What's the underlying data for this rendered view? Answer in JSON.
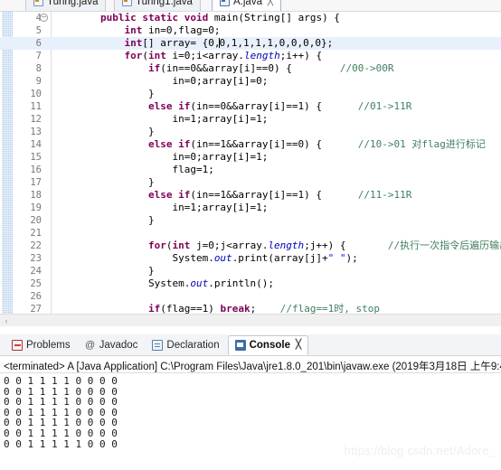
{
  "window": {
    "tabs": [
      {
        "label": "Turing.java",
        "active": false,
        "icon": "java-file-icon"
      },
      {
        "label": "Turing1.java",
        "active": false,
        "icon": "java-file-icon"
      },
      {
        "label": "A.java",
        "active": true,
        "icon": "java-file-icon",
        "close": "╳"
      }
    ]
  },
  "editor": {
    "lines": [
      {
        "num": "4",
        "fold": true,
        "current": false,
        "indent": 2,
        "tokens": [
          {
            "t": "kw",
            "v": "public"
          },
          {
            "t": "p",
            "v": " "
          },
          {
            "t": "kw",
            "v": "static"
          },
          {
            "t": "p",
            "v": " "
          },
          {
            "t": "kw",
            "v": "void"
          },
          {
            "t": "p",
            "v": " main(String[] args) {"
          }
        ]
      },
      {
        "num": "5",
        "fold": false,
        "current": false,
        "indent": 3,
        "tokens": [
          {
            "t": "kw",
            "v": "int"
          },
          {
            "t": "p",
            "v": " in=0,flag=0;"
          }
        ]
      },
      {
        "num": "6",
        "fold": false,
        "current": true,
        "indent": 3,
        "tokens": [
          {
            "t": "kw",
            "v": "int"
          },
          {
            "t": "p",
            "v": "[] array= {0,"
          },
          {
            "t": "caret",
            "v": ""
          },
          {
            "t": "p",
            "v": "0,1,1,1,1,0,0,0,0};"
          }
        ]
      },
      {
        "num": "7",
        "fold": false,
        "current": false,
        "indent": 3,
        "tokens": [
          {
            "t": "kw",
            "v": "for"
          },
          {
            "t": "p",
            "v": "("
          },
          {
            "t": "kw",
            "v": "int"
          },
          {
            "t": "p",
            "v": " i=0;i<array."
          },
          {
            "t": "fld",
            "v": "length"
          },
          {
            "t": "p",
            "v": ";i++) {"
          }
        ]
      },
      {
        "num": "8",
        "fold": false,
        "current": false,
        "indent": 4,
        "tokens": [
          {
            "t": "kw",
            "v": "if"
          },
          {
            "t": "p",
            "v": "(in==0&&array[i]==0) {"
          },
          {
            "t": "gap",
            "v": "        "
          },
          {
            "t": "cmt",
            "v": "//00->00R"
          }
        ]
      },
      {
        "num": "9",
        "fold": false,
        "current": false,
        "indent": 5,
        "tokens": [
          {
            "t": "p",
            "v": "in=0;array[i]=0;"
          }
        ]
      },
      {
        "num": "10",
        "fold": false,
        "current": false,
        "indent": 4,
        "tokens": [
          {
            "t": "p",
            "v": "}"
          }
        ]
      },
      {
        "num": "11",
        "fold": false,
        "current": false,
        "indent": 4,
        "tokens": [
          {
            "t": "kw",
            "v": "else"
          },
          {
            "t": "p",
            "v": " "
          },
          {
            "t": "kw",
            "v": "if"
          },
          {
            "t": "p",
            "v": "(in==0&&array[i]==1) {"
          },
          {
            "t": "gap",
            "v": "      "
          },
          {
            "t": "cmt",
            "v": "//01->11R"
          }
        ]
      },
      {
        "num": "12",
        "fold": false,
        "current": false,
        "indent": 5,
        "tokens": [
          {
            "t": "p",
            "v": "in=1;array[i]=1;"
          }
        ]
      },
      {
        "num": "13",
        "fold": false,
        "current": false,
        "indent": 4,
        "tokens": [
          {
            "t": "p",
            "v": "}"
          }
        ]
      },
      {
        "num": "14",
        "fold": false,
        "current": false,
        "indent": 4,
        "tokens": [
          {
            "t": "kw",
            "v": "else"
          },
          {
            "t": "p",
            "v": " "
          },
          {
            "t": "kw",
            "v": "if"
          },
          {
            "t": "p",
            "v": "(in==1&&array[i]==0) {"
          },
          {
            "t": "gap",
            "v": "      "
          },
          {
            "t": "cmt",
            "v": "//10->01 对flag进行标记"
          }
        ]
      },
      {
        "num": "15",
        "fold": false,
        "current": false,
        "indent": 5,
        "tokens": [
          {
            "t": "p",
            "v": "in=0;array[i]=1;"
          }
        ]
      },
      {
        "num": "16",
        "fold": false,
        "current": false,
        "indent": 5,
        "tokens": [
          {
            "t": "p",
            "v": "flag=1;"
          }
        ]
      },
      {
        "num": "17",
        "fold": false,
        "current": false,
        "indent": 4,
        "tokens": [
          {
            "t": "p",
            "v": "}"
          }
        ]
      },
      {
        "num": "18",
        "fold": false,
        "current": false,
        "indent": 4,
        "tokens": [
          {
            "t": "kw",
            "v": "else"
          },
          {
            "t": "p",
            "v": " "
          },
          {
            "t": "kw",
            "v": "if"
          },
          {
            "t": "p",
            "v": "(in==1&&array[i]==1) {"
          },
          {
            "t": "gap",
            "v": "      "
          },
          {
            "t": "cmt",
            "v": "//11->11R"
          }
        ]
      },
      {
        "num": "19",
        "fold": false,
        "current": false,
        "indent": 5,
        "tokens": [
          {
            "t": "p",
            "v": "in=1;array[i]=1;"
          }
        ]
      },
      {
        "num": "20",
        "fold": false,
        "current": false,
        "indent": 4,
        "tokens": [
          {
            "t": "p",
            "v": "}"
          }
        ]
      },
      {
        "num": "21",
        "fold": false,
        "current": false,
        "indent": 0,
        "tokens": []
      },
      {
        "num": "22",
        "fold": false,
        "current": false,
        "indent": 4,
        "tokens": [
          {
            "t": "kw",
            "v": "for"
          },
          {
            "t": "p",
            "v": "("
          },
          {
            "t": "kw",
            "v": "int"
          },
          {
            "t": "p",
            "v": " j=0;j<array."
          },
          {
            "t": "fld",
            "v": "length"
          },
          {
            "t": "p",
            "v": ";j++) {"
          },
          {
            "t": "gap",
            "v": "       "
          },
          {
            "t": "cmt",
            "v": "//执行一次指令后遍历输出"
          }
        ]
      },
      {
        "num": "23",
        "fold": false,
        "current": false,
        "indent": 5,
        "tokens": [
          {
            "t": "p",
            "v": "System."
          },
          {
            "t": "fld",
            "v": "out"
          },
          {
            "t": "p",
            "v": ".print(array[j]+"
          },
          {
            "t": "str",
            "v": "\" \""
          },
          {
            "t": "p",
            "v": ");"
          }
        ]
      },
      {
        "num": "24",
        "fold": false,
        "current": false,
        "indent": 4,
        "tokens": [
          {
            "t": "p",
            "v": "}"
          }
        ]
      },
      {
        "num": "25",
        "fold": false,
        "current": false,
        "indent": 4,
        "tokens": [
          {
            "t": "p",
            "v": "System."
          },
          {
            "t": "fld",
            "v": "out"
          },
          {
            "t": "p",
            "v": ".println();"
          }
        ]
      },
      {
        "num": "26",
        "fold": false,
        "current": false,
        "indent": 0,
        "tokens": []
      },
      {
        "num": "27",
        "fold": false,
        "current": false,
        "indent": 4,
        "tokens": [
          {
            "t": "kw",
            "v": "if"
          },
          {
            "t": "p",
            "v": "(flag==1) "
          },
          {
            "t": "kw",
            "v": "break"
          },
          {
            "t": "p",
            "v": ";"
          },
          {
            "t": "gap",
            "v": "    "
          },
          {
            "t": "cmt",
            "v": "//flag==1时, stop"
          }
        ]
      },
      {
        "num": "28",
        "fold": false,
        "current": false,
        "indent": 3,
        "tokens": [
          {
            "t": "p",
            "v": "}"
          }
        ]
      },
      {
        "num": "29",
        "fold": false,
        "current": false,
        "indent": 2,
        "tokens": [
          {
            "t": "p",
            "v": "}"
          }
        ]
      },
      {
        "num": "30",
        "fold": false,
        "current": false,
        "indent": 1,
        "tokens": [
          {
            "t": "p",
            "v": "}"
          }
        ]
      }
    ],
    "hscroll_left_arrow": "‹"
  },
  "bottom_panel": {
    "tabs": [
      {
        "label": "Problems",
        "active": false,
        "icon": "problems-icon"
      },
      {
        "label": "Javadoc",
        "active": false,
        "icon": "javadoc-icon"
      },
      {
        "label": "Declaration",
        "active": false,
        "icon": "declaration-icon"
      },
      {
        "label": "Console",
        "active": true,
        "icon": "console-icon",
        "close": "╳"
      }
    ],
    "terminated_line": "<terminated> A [Java Application] C:\\Program Files\\Java\\jre1.8.0_201\\bin\\javaw.exe (2019年3月18日 上午9:4",
    "output_lines": [
      "0 0 1 1 1 1 0 0 0 0",
      "0 0 1 1 1 1 0 0 0 0",
      "0 0 1 1 1 1 0 0 0 0",
      "0 0 1 1 1 1 0 0 0 0",
      "0 0 1 1 1 1 0 0 0 0",
      "0 0 1 1 1 1 0 0 0 0",
      "0 0 1 1 1 1 1 0 0 0"
    ]
  },
  "watermark": {
    "text": "https://blog.csdn.net/Adore_"
  },
  "colors": {
    "keyword": "#7f0055",
    "comment": "#3f7f5f",
    "string": "#2a00ff",
    "field": "#0000c0",
    "current_line": "#e8f0fb",
    "gutter": "#a8c8e8"
  }
}
